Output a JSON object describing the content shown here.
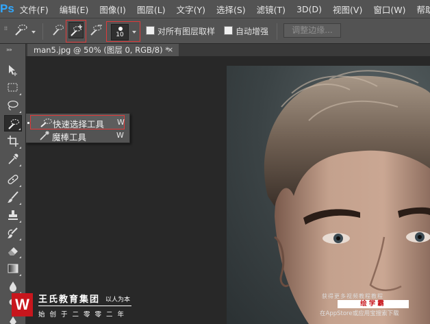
{
  "app": {
    "logo": "Ps",
    "menu": [
      "文件(F)",
      "编辑(E)",
      "图像(I)",
      "图层(L)",
      "文字(Y)",
      "选择(S)",
      "滤镜(T)",
      "3D(D)",
      "视图(V)",
      "窗口(W)",
      "帮助"
    ]
  },
  "options_bar": {
    "brush_size": "10",
    "sample_all_layers_label": "对所有图层取样",
    "sample_all_layers_checked": false,
    "auto_enhance_label": "自动增强",
    "auto_enhance_checked": false,
    "refine_edge_label": "调整边缘..."
  },
  "document_tab": {
    "title": "man5.jpg @ 50% (图层 0, RGB/8) *",
    "close": "×"
  },
  "tool_flyout": {
    "items": [
      {
        "label": "快速选择工具",
        "shortcut": "W",
        "selected": true,
        "icon": "quick-selection-icon"
      },
      {
        "label": "魔棒工具",
        "shortcut": "W",
        "selected": false,
        "icon": "magic-wand-icon"
      }
    ]
  },
  "watermark": {
    "logo_letter": "W",
    "title": "王氏教育集团",
    "subtitle": "以人为本",
    "motto": "始创于二零零二年",
    "ad_top": "获得更多视频教程教程",
    "ad_brand": "绘学霸",
    "ad_bottom": "在AppStore或应用宝搜索下载"
  },
  "colors": {
    "panel": "#535353",
    "canvas_bg": "#282828",
    "highlight": "#e03a3a",
    "ps_blue": "#31a8ff",
    "brand_red": "#c8161d"
  }
}
